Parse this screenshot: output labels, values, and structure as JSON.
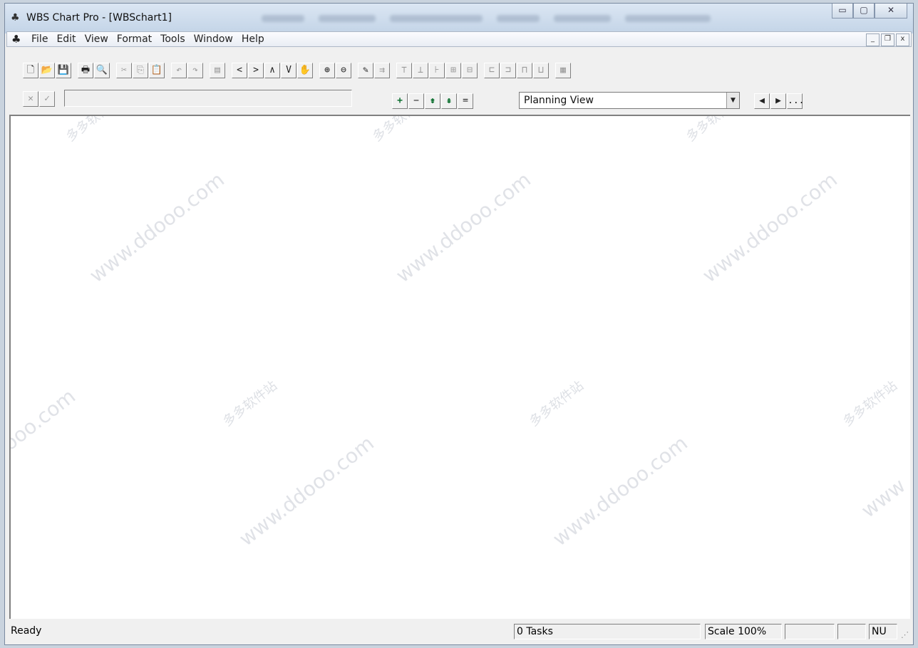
{
  "window": {
    "title": "WBS Chart Pro - [WBSchart1]",
    "caption_buttons": {
      "minimize": "▭",
      "maximize": "▢",
      "close": "✕"
    }
  },
  "menubar": {
    "items": [
      "File",
      "Edit",
      "View",
      "Format",
      "Tools",
      "Window",
      "Help"
    ],
    "mdi_buttons": {
      "minimize": "_",
      "restore": "❐",
      "close": "x"
    }
  },
  "toolbar1": {
    "buttons": [
      {
        "name": "new-icon",
        "glyph": "🗋"
      },
      {
        "name": "open-icon",
        "glyph": "📂"
      },
      {
        "name": "save-icon",
        "glyph": "💾"
      },
      {
        "name": "print-icon",
        "glyph": "🖶"
      },
      {
        "name": "print-preview-icon",
        "glyph": "🔍"
      },
      {
        "name": "cut-icon",
        "glyph": "✂"
      },
      {
        "name": "copy-icon",
        "glyph": "⎘"
      },
      {
        "name": "paste-icon",
        "glyph": "📋"
      },
      {
        "name": "undo-icon",
        "glyph": "↶"
      },
      {
        "name": "redo-icon",
        "glyph": "↷"
      },
      {
        "name": "task-info-icon",
        "glyph": "▤"
      },
      {
        "name": "move-left-icon",
        "glyph": "<"
      },
      {
        "name": "move-right-icon",
        "glyph": ">"
      },
      {
        "name": "move-up-icon",
        "glyph": "∧"
      },
      {
        "name": "move-down-icon",
        "glyph": "V"
      },
      {
        "name": "hand-icon",
        "glyph": "✋"
      },
      {
        "name": "zoom-in-icon",
        "glyph": "⊕"
      },
      {
        "name": "zoom-out-icon",
        "glyph": "⊖"
      },
      {
        "name": "format-icon",
        "glyph": "✎"
      },
      {
        "name": "outline-icon",
        "glyph": "⇉"
      },
      {
        "name": "layout-1-icon",
        "glyph": "⊤"
      },
      {
        "name": "layout-2-icon",
        "glyph": "⊥"
      },
      {
        "name": "layout-3-icon",
        "glyph": "⊦"
      },
      {
        "name": "layout-4-icon",
        "glyph": "⊞"
      },
      {
        "name": "layout-5-icon",
        "glyph": "⊟"
      },
      {
        "name": "align-1-icon",
        "glyph": "⊏"
      },
      {
        "name": "align-2-icon",
        "glyph": "⊐"
      },
      {
        "name": "align-3-icon",
        "glyph": "⊓"
      },
      {
        "name": "align-4-icon",
        "glyph": "⊔"
      },
      {
        "name": "grid-icon",
        "glyph": "▦"
      }
    ]
  },
  "toolbar2": {
    "cancel": "✕",
    "accept": "✓",
    "edit_value": "",
    "outline_buttons": [
      {
        "name": "add-icon",
        "glyph": "+"
      },
      {
        "name": "remove-icon",
        "glyph": "−"
      },
      {
        "name": "expand-icon",
        "glyph": "⇟"
      },
      {
        "name": "collapse-icon",
        "glyph": "⇞"
      },
      {
        "name": "level-icon",
        "glyph": "="
      }
    ],
    "view_select": "Planning View",
    "nav": {
      "prev": "◀",
      "next": "▶",
      "more": "..."
    }
  },
  "watermark": {
    "url": "www.ddooo.com",
    "cn": "多多软件站",
    "partial": "ooo.com",
    "www": "www"
  },
  "statusbar": {
    "ready": "Ready",
    "tasks": "0 Tasks",
    "scale": "Scale 100%",
    "nu": "NU"
  }
}
